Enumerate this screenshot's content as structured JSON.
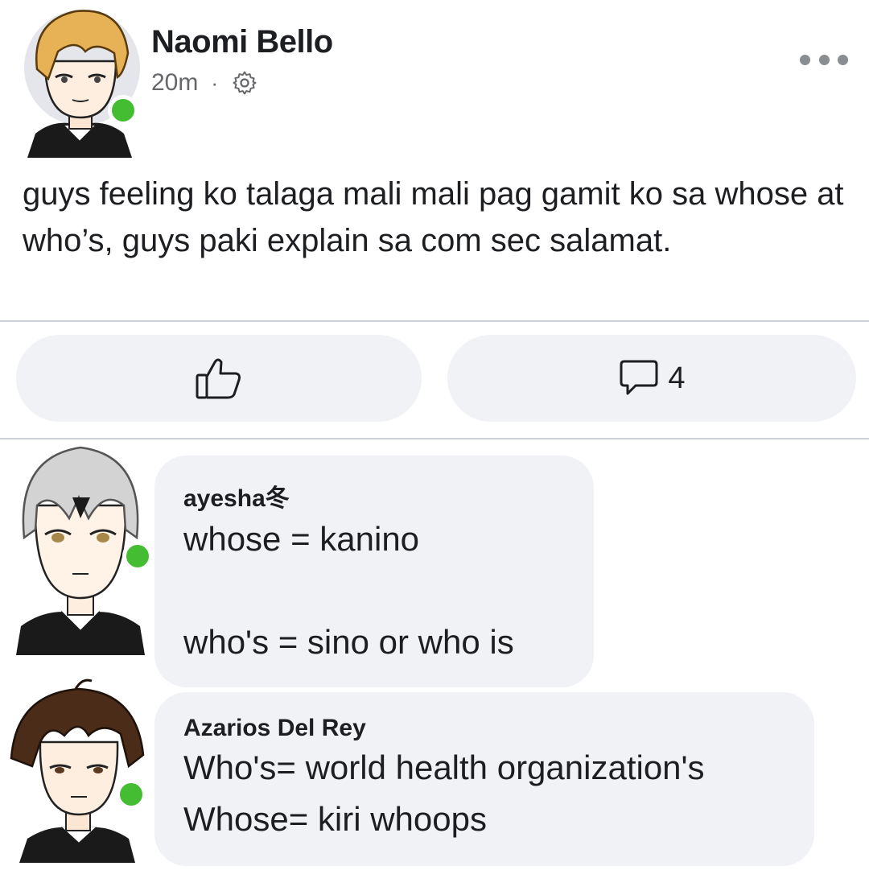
{
  "post": {
    "author": "Naomi Bello",
    "time": "20m",
    "separator": "·",
    "text": "guys feeling ko talaga mali mali pag gamit ko sa whose at who’s, guys paki explain sa com sec salamat.",
    "online": true
  },
  "actions": {
    "like_icon": "thumbs-up-icon",
    "comment_icon": "comment-icon",
    "comment_count": "4"
  },
  "comments": [
    {
      "author": "ayesha冬",
      "text": "whose = kanino\n\nwho's = sino or who is",
      "online": true
    },
    {
      "author": "Azarios Del Rey",
      "text": "Who's= world health organization's\nWhose= kiri whoops",
      "online": true
    }
  ],
  "colors": {
    "online": "#44bd32",
    "bubble": "#f0f2f5",
    "meta": "#65676b"
  }
}
